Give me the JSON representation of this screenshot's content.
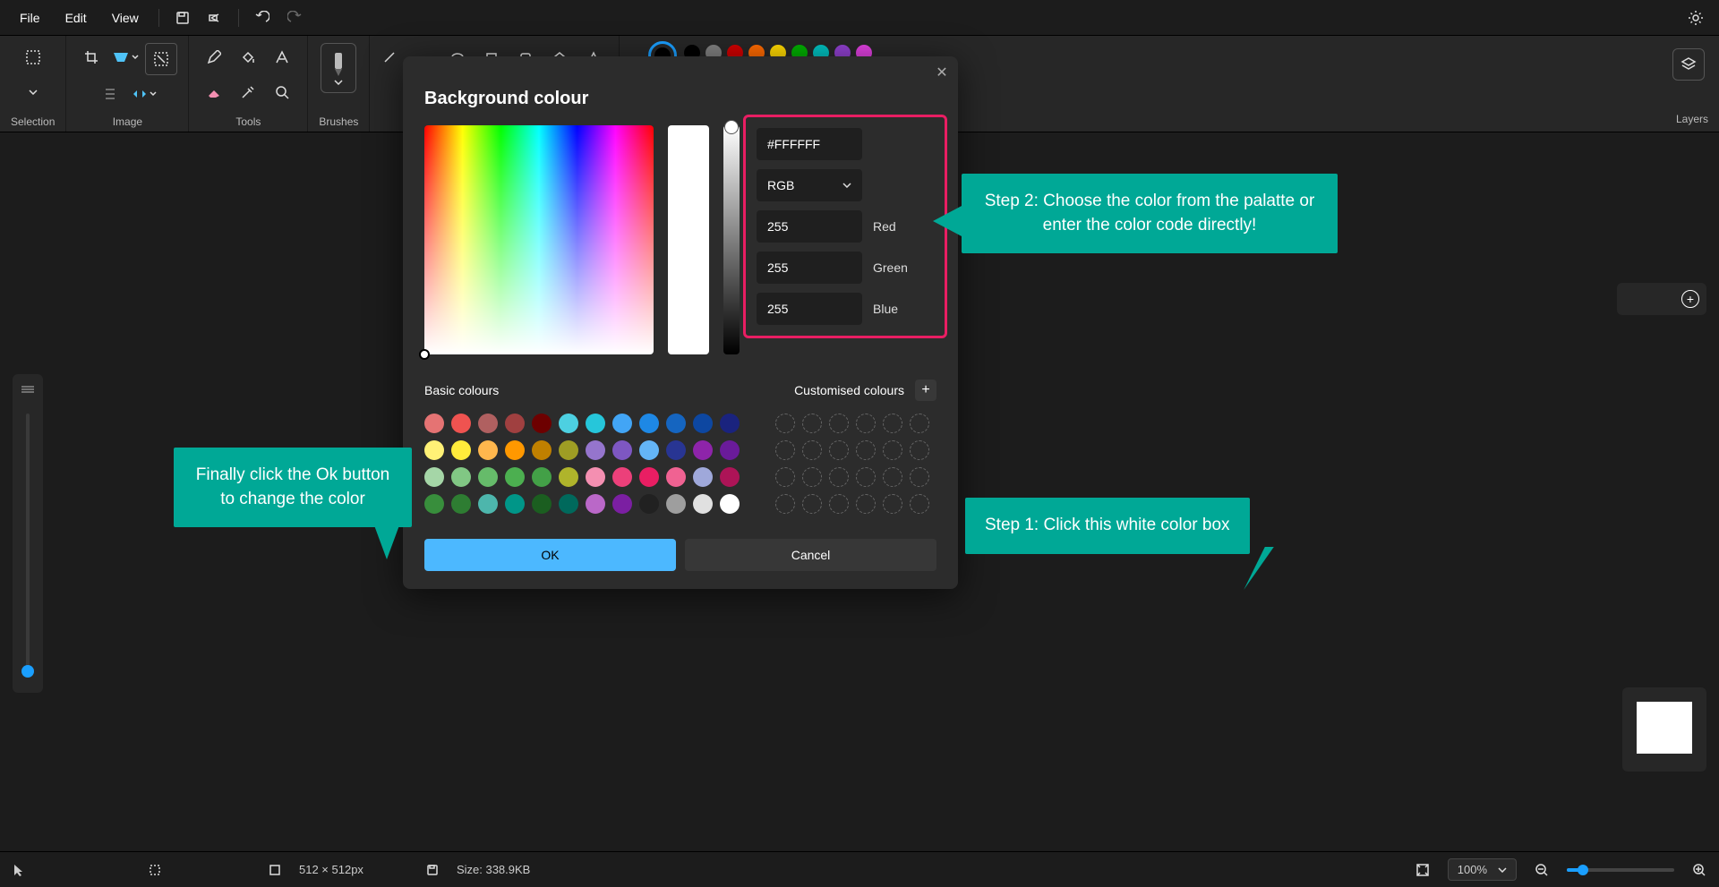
{
  "menu": {
    "file": "File",
    "edit": "Edit",
    "view": "View"
  },
  "ribbon": {
    "selection": "Selection",
    "image": "Image",
    "tools": "Tools",
    "brushes": "Brushes",
    "layers": "Layers"
  },
  "palette_colors": [
    "#000000",
    "#808080",
    "#d00000",
    "#ff6a00",
    "#ffd800",
    "#00b000",
    "#00c0c0",
    "#9040d0",
    "#e040e0"
  ],
  "dialog": {
    "title": "Background colour",
    "hex": "#FFFFFF",
    "mode": "RGB",
    "red_value": "255",
    "red_label": "Red",
    "green_value": "255",
    "green_label": "Green",
    "blue_value": "255",
    "blue_label": "Blue",
    "basic_label": "Basic colours",
    "custom_label": "Customised colours",
    "ok": "OK",
    "cancel": "Cancel",
    "basic_colors": [
      "#e57373",
      "#ef5350",
      "#b06060",
      "#a04040",
      "#6d0000",
      "#4dd0e1",
      "#26c6da",
      "#42a5f5",
      "#1e88e5",
      "#1565c0",
      "#0d47a1",
      "#1a237e",
      "#fff176",
      "#ffeb3b",
      "#ffb74d",
      "#ff9800",
      "#c08000",
      "#9e9d24",
      "#9575cd",
      "#7e57c2",
      "#64b5f6",
      "#283593",
      "#8e24aa",
      "#6a1b9a",
      "#a5d6a7",
      "#81c784",
      "#66bb6a",
      "#4caf50",
      "#43a047",
      "#afb42b",
      "#f48fb1",
      "#ec407a",
      "#e91e63",
      "#f06292",
      "#9fa8da",
      "#ad1457",
      "#388e3c",
      "#2e7d32",
      "#4db6ac",
      "#009688",
      "#1b5e20",
      "#00695c",
      "#ba68c8",
      "#7b1fa2",
      "#212121",
      "#9e9e9e",
      "#e0e0e0",
      "#ffffff"
    ]
  },
  "callouts": {
    "step1": "Step 1: Click this white color box",
    "step2": "Step 2: Choose the color from the palatte or enter the color code directly!",
    "final": "Finally click the Ok button to change the color"
  },
  "status": {
    "dimensions": "512 × 512px",
    "size_label": "Size:",
    "size_value": "338.9KB",
    "zoom": "100%"
  }
}
